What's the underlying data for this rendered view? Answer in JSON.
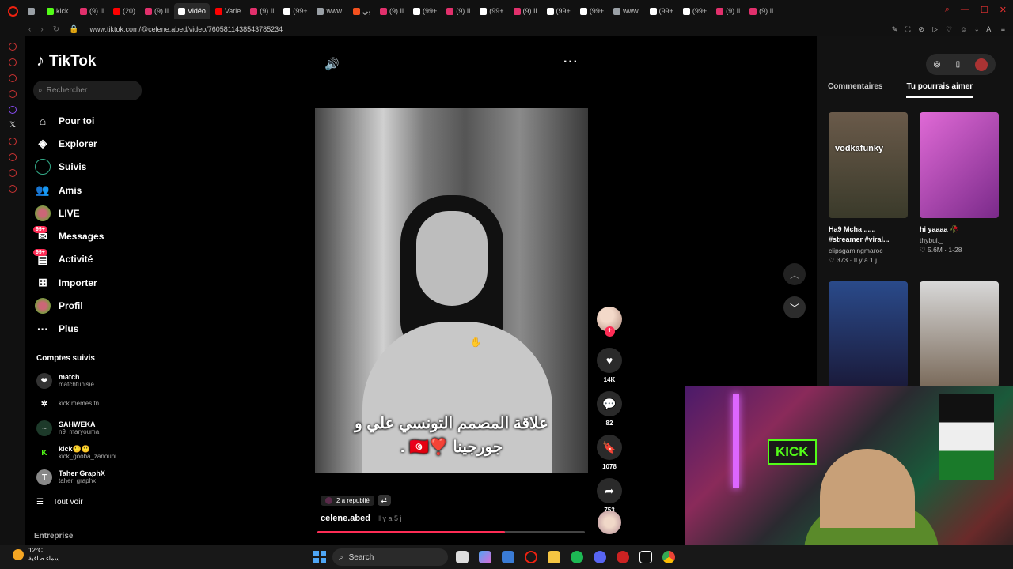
{
  "browser": {
    "tabs": [
      {
        "label": "",
        "color": "#9aa0a6"
      },
      {
        "label": "kick.",
        "color": "#53fc18"
      },
      {
        "label": "(9) Il",
        "color": "#e1306c"
      },
      {
        "label": "(20)",
        "color": "#ff0000"
      },
      {
        "label": "(9) Il",
        "color": "#e1306c"
      },
      {
        "label": "Vidéo",
        "color": "#ffffff",
        "active": true
      },
      {
        "label": "Varie",
        "color": "#ff0000"
      },
      {
        "label": "(9) Il",
        "color": "#e1306c"
      },
      {
        "label": "(99+",
        "color": "#ffffff"
      },
      {
        "label": "www.",
        "color": "#9aa0a6"
      },
      {
        "label": "بي",
        "color": "#f4511e"
      },
      {
        "label": "(9) Il",
        "color": "#e1306c"
      },
      {
        "label": "(99+",
        "color": "#ffffff"
      },
      {
        "label": "(9) Il",
        "color": "#e1306c"
      },
      {
        "label": "(99+",
        "color": "#ffffff"
      },
      {
        "label": "(9) Il",
        "color": "#e1306c"
      },
      {
        "label": "(99+",
        "color": "#ffffff"
      },
      {
        "label": "(99+",
        "color": "#ffffff"
      },
      {
        "label": "www.",
        "color": "#9aa0a6"
      },
      {
        "label": "(99+",
        "color": "#ffffff"
      },
      {
        "label": "(99+",
        "color": "#ffffff"
      },
      {
        "label": "(9) Il",
        "color": "#e1306c"
      },
      {
        "label": "(9) Il",
        "color": "#e1306c"
      }
    ],
    "url": "www.tiktok.com/@celene.abed/video/7605811438543785234",
    "ai_label": "AI"
  },
  "sidebar": {
    "logo": "TikTok",
    "search_placeholder": "Rechercher",
    "nav": [
      {
        "label": "Pour toi",
        "icon": "home-icon",
        "glyph": "⌂"
      },
      {
        "label": "Explorer",
        "icon": "compass-icon",
        "glyph": "◈"
      },
      {
        "label": "Suivis",
        "icon": "following-icon",
        "glyph": ""
      },
      {
        "label": "Amis",
        "icon": "friends-icon",
        "glyph": "👥"
      },
      {
        "label": "LIVE",
        "icon": "live-avatar-icon",
        "glyph": ""
      },
      {
        "label": "Messages",
        "icon": "message-icon",
        "glyph": "✉",
        "badge": "99+"
      },
      {
        "label": "Activité",
        "icon": "activity-icon",
        "glyph": "▤",
        "badge": "99+"
      },
      {
        "label": "Importer",
        "icon": "upload-icon",
        "glyph": "⊞"
      },
      {
        "label": "Profil",
        "icon": "profile-avatar-icon",
        "glyph": ""
      },
      {
        "label": "Plus",
        "icon": "more-icon",
        "glyph": "···"
      }
    ],
    "following_title": "Comptes suivis",
    "following": [
      {
        "name": "match",
        "handle": "matchtunisie",
        "bg": "#333",
        "glyph": "❤"
      },
      {
        "name": "",
        "handle": "kick.memes.tn",
        "bg": "#000",
        "glyph": "✲"
      },
      {
        "name": "SAHWEKA",
        "handle": "n9_maryouma",
        "bg": "#1d3a2a",
        "glyph": "~"
      },
      {
        "name": "kick🙂🙂",
        "handle": "kick_gooba_zanouni",
        "bg": "#000",
        "glyph": "K"
      },
      {
        "name": "Taher GraphX",
        "handle": "taher_graphx",
        "bg": "#888",
        "glyph": "T"
      }
    ],
    "see_all": "Tout voir",
    "enterprise": "Entreprise"
  },
  "video": {
    "caption_line1": "علاقة المصمم التونسي علي و",
    "caption_line2": "جورجينا ❣️🇹🇳 .",
    "reposted": "2 a republié",
    "author": "celene.abed",
    "ago": "· Il y a 5 j",
    "progress": 0.7
  },
  "actions": {
    "likes": "14K",
    "comments": "82",
    "saves": "1078",
    "shares": "753"
  },
  "right_panel": {
    "tabs": [
      "Commentaires",
      "Tu pourrais aimer"
    ],
    "recs": [
      {
        "title": "Ha9 Mcha ...... #streamer #viral...",
        "author": "clipsgamingmaroc",
        "stats": "♡ 373 · Il y a 1 j",
        "overlay": "vodkafunky",
        "bg": "linear-gradient(#6a5a4a,#3a3a2a)"
      },
      {
        "title": "hi yaaaa 🥀",
        "author": "thybui._",
        "stats": "♡ 5.6M · 1-28",
        "overlay": "",
        "bg": "linear-gradient(135deg,#e06ad6,#7a2a8a)"
      },
      {
        "title": "",
        "author": "",
        "stats": "",
        "overlay": "",
        "bg": "linear-gradient(#2a4a8a,#1a1a3a)"
      },
      {
        "title": "",
        "author": "",
        "stats": "",
        "overlay": "",
        "bg": "linear-gradient(#d8d8d8,#7a6a5a)"
      }
    ]
  },
  "stream_overlay": {
    "sign": "KICK"
  },
  "taskbar": {
    "temp": "12°C",
    "weather": "سماء صافية",
    "search": "Search"
  }
}
